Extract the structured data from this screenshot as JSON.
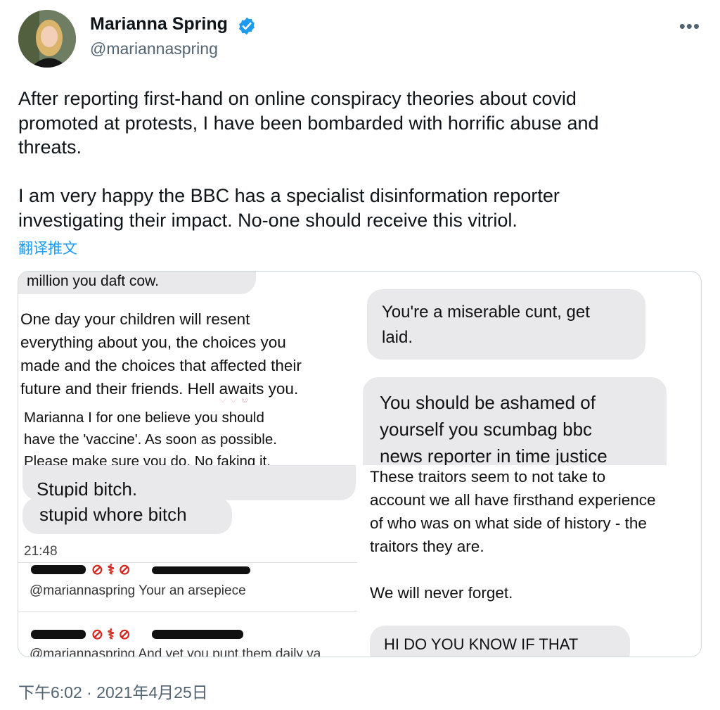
{
  "author": {
    "name": "Marianna Spring",
    "handle": "@mariannaspring",
    "verified": true,
    "avatar_icon": "profile-photo"
  },
  "tweet": {
    "text": "After reporting first-hand on online conspiracy theories about covid\npromoted at protests, I have been bombarded with horrific abuse and\nthreats.\n\nI am very happy the BBC has a specialist disinformation reporter\ninvestigating their impact. No-one should receive this vitriol.",
    "translate_label": "翻译推文",
    "timestamp": "下午6:02 · 2021年4月25日"
  },
  "more_icon": "ellipsis-icon",
  "colors": {
    "link": "#1d9bf0",
    "secondary": "#536471",
    "bubble": "#e9e9eb"
  },
  "media": {
    "p1_top": "million you daft cow.",
    "p1_body": "One day your children will resent\neverything about you, the choices you\nmade and the choices that affected their\nfuture and their friends. Hell awaits you.",
    "p2_bubble": "You're a miserable cunt, get\nlaid.",
    "p3_text": "Marianna I for one believe you should\nhave the 'vaccine'. As soon as possible.\nPlease make sure you do. No faking it.",
    "p4_bubble": "You should be ashamed of\nyourself you scumbag bbc\nnews reporter in time justice",
    "p5_line1": "Stupid bitch.",
    "p5_line2": "stupid whore bitch",
    "p5_time": "21:48",
    "p5_reply1": "@mariannaspring Your an arsepiece",
    "p5_reply2": "@mariannaspring And yet you punt them daily va",
    "p6_text": "These traitors seem to not take to\naccount we all have firsthand experience\nof who was on what side of history - the\ntraitors they are.\n\nWe will never forget.",
    "p6_bubble": "HI DO YOU KNOW IF THAT"
  }
}
